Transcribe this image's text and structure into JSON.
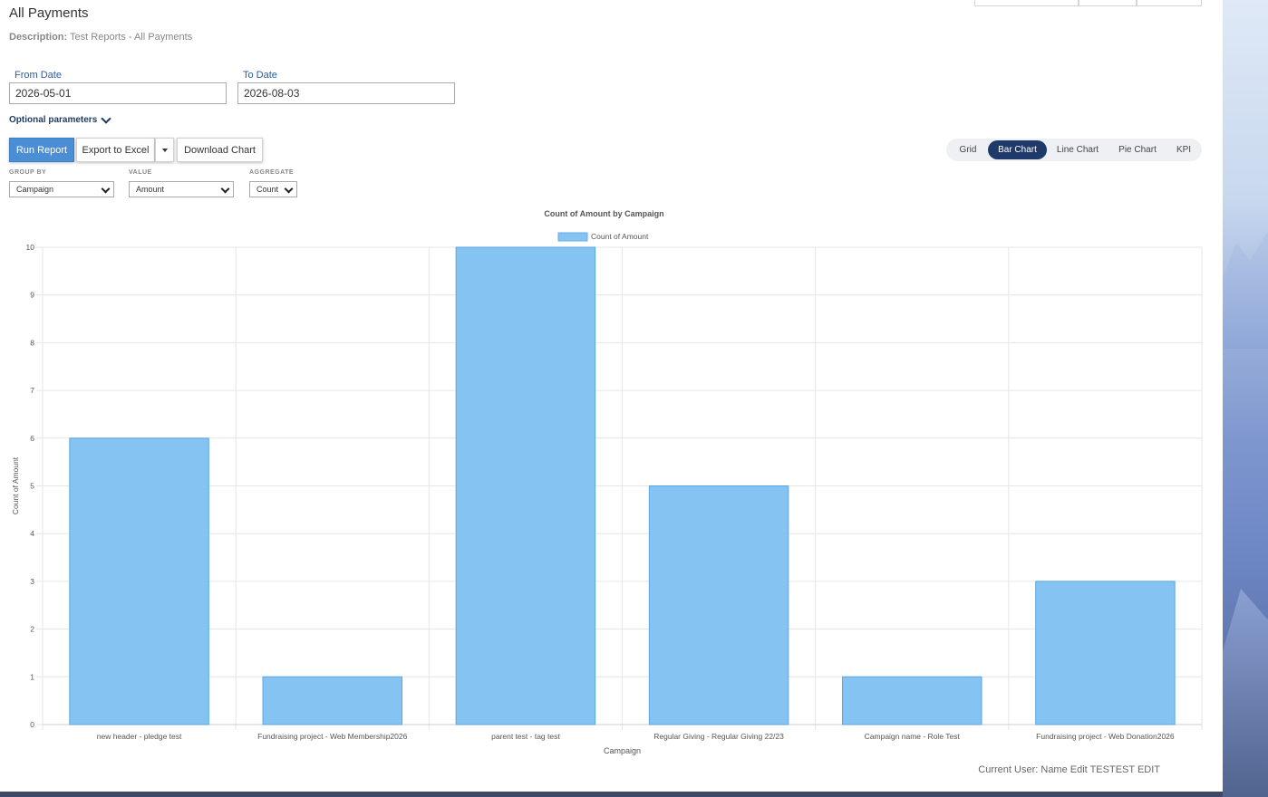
{
  "page": {
    "title": "All Payments",
    "description_label": "Description:",
    "description_text": "Test Reports - All Payments"
  },
  "filters": {
    "from_label": "From Date",
    "from_value": "2026-05-01",
    "to_label": "To Date",
    "to_value": "2026-08-03",
    "optional_params": "Optional parameters"
  },
  "toolbar": {
    "run": "Run Report",
    "export": "Export to Excel",
    "download": "Download Chart"
  },
  "views": [
    "Grid",
    "Bar Chart",
    "Line Chart",
    "Pie Chart",
    "KPI"
  ],
  "active_view": "Bar Chart",
  "selectors": {
    "group_by_label": "GROUP BY",
    "group_by_value": "Campaign",
    "value_label": "VALUE",
    "value_value": "Amount",
    "aggregate_label": "AGGREGATE",
    "aggregate_value": "Count"
  },
  "chart_data": {
    "type": "bar",
    "title": "Count of Amount by Campaign",
    "xlabel": "Campaign",
    "ylabel": "Count of Amount",
    "ylim": [
      0,
      10
    ],
    "legend_position": "top",
    "grid": true,
    "categories": [
      "new header - pledge test",
      "Fundraising project - Web Membership2026",
      "parent test - tag test",
      "Regular Giving - Regular Giving 22/23",
      "Campaign name - Role Test",
      "Fundraising project - Web Donation2026"
    ],
    "series": [
      {
        "name": "Count of Amount",
        "values": [
          6,
          1,
          10,
          5,
          1,
          3
        ],
        "color": "#85c4f2"
      }
    ]
  },
  "footer": {
    "current_user": "Current User: Name Edit TESTEST EDIT"
  }
}
